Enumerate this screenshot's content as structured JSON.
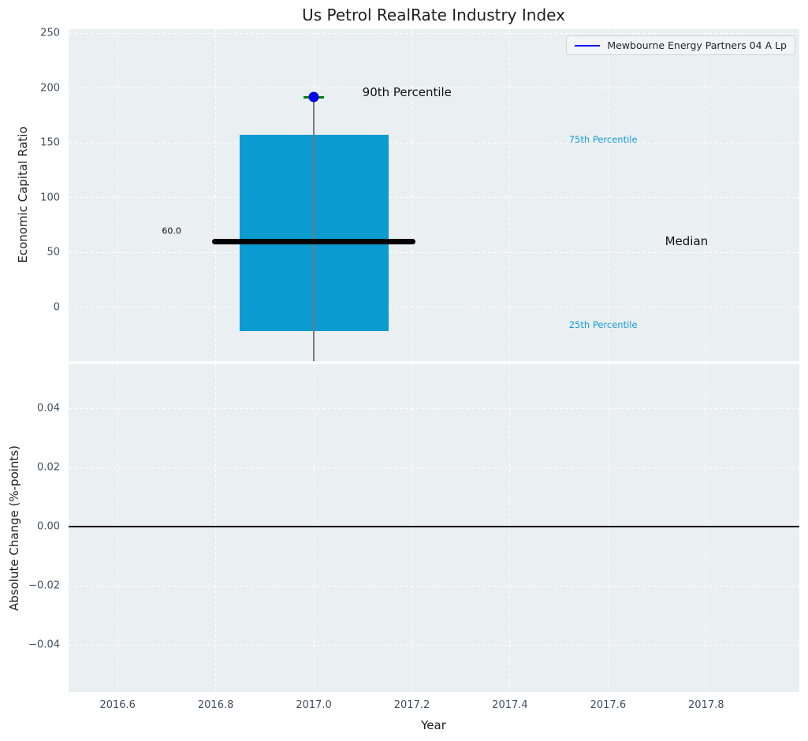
{
  "figure": {
    "title": "Us Petrol RealRate Industry Index"
  },
  "legend": {
    "items": [
      {
        "label": "Mewbourne Energy Partners 04 A Lp",
        "color": "#0000ee"
      }
    ]
  },
  "style": {
    "plot_bg": "#EAEFF1",
    "grid_color": "#ffffff",
    "tick_color": "#3f4f5f",
    "text_color": "#1f1f1f",
    "accent_cyan": "#0a9bd0",
    "accent_blue": "#0000ee",
    "accent_green": "#008000"
  },
  "chart_data": [
    {
      "type": "boxplot",
      "title": "Us Petrol RealRate Industry Index",
      "ylabel": "Economic Capital Ratio",
      "xlabel": "",
      "xlim": [
        2016.5,
        2017.99
      ],
      "ylim": [
        -48.9,
        253.6
      ],
      "grid": true,
      "legend_position": "upper right",
      "show_xtick_labels": false,
      "xticks": [
        {
          "v": 2016.6,
          "label": "2016.6"
        },
        {
          "v": 2016.8,
          "label": "2016.8"
        },
        {
          "v": 2017.0,
          "label": "2017.0"
        },
        {
          "v": 2017.2,
          "label": "2017.2"
        },
        {
          "v": 2017.4,
          "label": "2017.4"
        },
        {
          "v": 2017.6,
          "label": "2017.6"
        },
        {
          "v": 2017.8,
          "label": "2017.8"
        }
      ],
      "yticks": [
        {
          "v": 250,
          "label": "250"
        },
        {
          "v": 200,
          "label": "200"
        },
        {
          "v": 150,
          "label": "150"
        },
        {
          "v": 100,
          "label": "100"
        },
        {
          "v": 50,
          "label": "50"
        },
        {
          "v": 0,
          "label": "0"
        }
      ],
      "box": {
        "x": 2017.0,
        "q1": -21.6,
        "median": 60.0,
        "q3": 157.3,
        "p90": 191.5,
        "whisker_low": -48.9,
        "box_halfwidth": 0.152,
        "median_halfwidth": 0.207,
        "cap_halfwidth": 0.021,
        "box_color": "#0a9bd0",
        "median_color": "#000000",
        "median_thickness": 7,
        "whisker_color": "#7a7a7a",
        "cap_color": "#008000"
      },
      "series": [
        {
          "name": "Mewbourne Energy Partners 04 A Lp",
          "color": "#0000ee",
          "marker": "circle",
          "points": [
            {
              "x": 2017.0,
              "y": 191.5
            }
          ]
        }
      ],
      "annotations": [
        {
          "text": "60.0",
          "x": 2016.71,
          "y": 70,
          "color": "#111111",
          "size": 11
        },
        {
          "text": "90th Percentile",
          "x": 2017.19,
          "y": 196,
          "color": "#111111",
          "size": 15
        },
        {
          "text": "75th Percentile",
          "x": 2017.59,
          "y": 153,
          "color": "#169bd7",
          "size": 11.5
        },
        {
          "text": "Median",
          "x": 2017.76,
          "y": 60.5,
          "color": "#111111",
          "size": 15
        },
        {
          "text": "25th Percentile",
          "x": 2017.59,
          "y": -15.5,
          "color": "#169bd7",
          "size": 11.5
        }
      ]
    },
    {
      "type": "line",
      "title": "",
      "ylabel": "Absolute Change (%-points)",
      "xlabel": "Year",
      "xlim": [
        2016.5,
        2017.99
      ],
      "ylim": [
        -0.056,
        0.055
      ],
      "grid": true,
      "show_xtick_labels": true,
      "xticks": [
        {
          "v": 2016.6,
          "label": "2016.6"
        },
        {
          "v": 2016.8,
          "label": "2016.8"
        },
        {
          "v": 2017.0,
          "label": "2017.0"
        },
        {
          "v": 2017.2,
          "label": "2017.2"
        },
        {
          "v": 2017.4,
          "label": "2017.4"
        },
        {
          "v": 2017.6,
          "label": "2017.6"
        },
        {
          "v": 2017.8,
          "label": "2017.8"
        }
      ],
      "yticks": [
        {
          "v": 0.04,
          "label": "0.04"
        },
        {
          "v": 0.02,
          "label": "0.02"
        },
        {
          "v": 0,
          "label": "0.00"
        },
        {
          "v": -0.02,
          "label": "−0.02"
        },
        {
          "v": -0.04,
          "label": "−0.04"
        }
      ],
      "zero_line": {
        "y": 0,
        "color": "#000000",
        "width": 2
      },
      "series": []
    }
  ]
}
